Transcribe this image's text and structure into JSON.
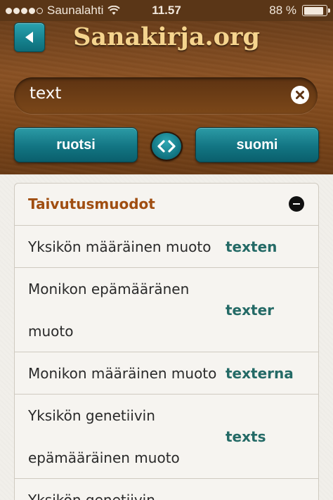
{
  "status_bar": {
    "carrier": "Saunalahti",
    "time": "11.57",
    "battery_percent": "88 %",
    "battery_level": 0.88,
    "signal_bars": 4
  },
  "header": {
    "app_title": "Sanakirja.org",
    "back_icon": "back-arrow-icon"
  },
  "search": {
    "value": "text",
    "clear_icon": "clear-icon"
  },
  "languages": {
    "source": "ruotsi",
    "target": "suomi",
    "swap_icon": "swap-arrows-icon"
  },
  "section": {
    "title": "Taivutusmuodot",
    "collapse_icon": "minus-circle-icon"
  },
  "forms": [
    {
      "label": "Yksikön määräinen muoto",
      "value": "texten"
    },
    {
      "label": "Monikon epämääränen muoto",
      "value": "texter"
    },
    {
      "label": "Monikon määräinen muoto",
      "value": "texterna"
    },
    {
      "label": "Yksikön genetiivin epämääräinen muoto",
      "value": "texts"
    },
    {
      "label": "Yksikön genetiivin",
      "value": ""
    }
  ],
  "colors": {
    "accent_teal": "#127583",
    "section_title": "#a04e11",
    "value_text": "#246a66",
    "title_gold": "#f5d48e"
  }
}
